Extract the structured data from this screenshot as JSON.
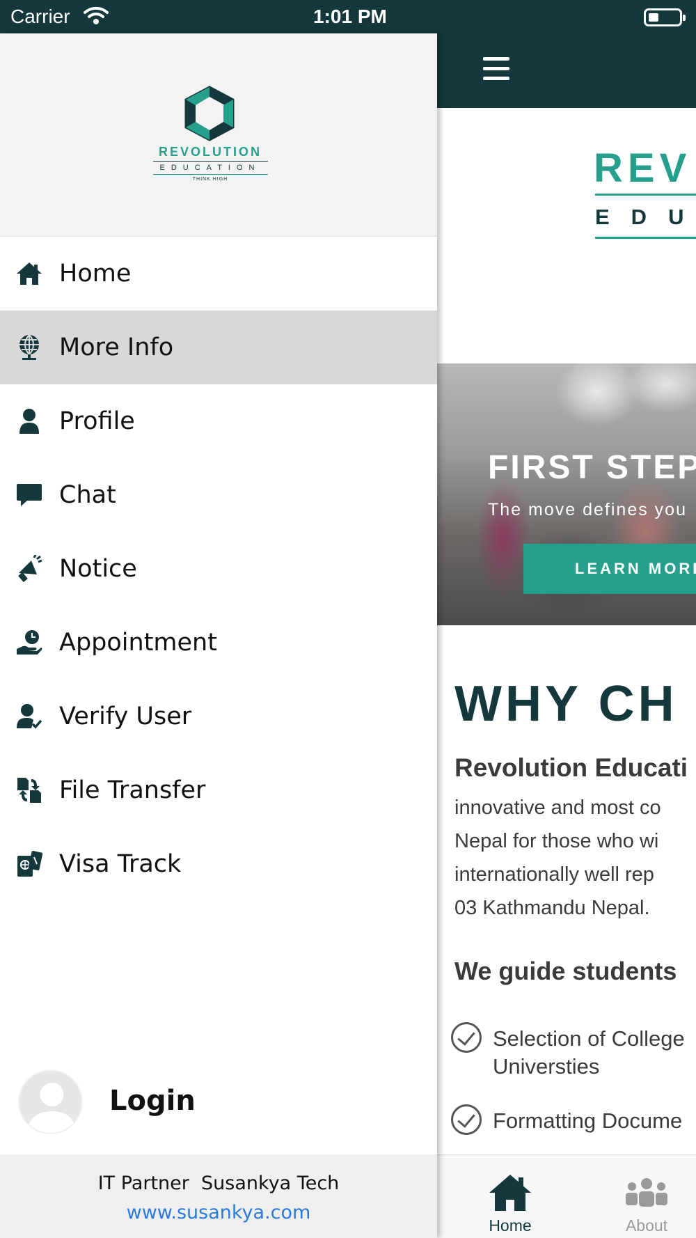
{
  "status_bar": {
    "carrier": "Carrier",
    "time": "1:01 PM"
  },
  "drawer": {
    "logo": {
      "word": "REVOLUTION",
      "sub": "EDUCATION",
      "tagline": "THINK HIGH"
    },
    "menu": [
      {
        "label": "Home",
        "icon": "home-icon"
      },
      {
        "label": "More Info",
        "icon": "globe-icon",
        "active": true
      },
      {
        "label": "Profile",
        "icon": "user-icon"
      },
      {
        "label": "Chat",
        "icon": "chat-icon"
      },
      {
        "label": "Notice",
        "icon": "megaphone-icon"
      },
      {
        "label": "Appointment",
        "icon": "hand-clock-icon"
      },
      {
        "label": "Verify User",
        "icon": "user-check-icon"
      },
      {
        "label": "File Transfer",
        "icon": "file-transfer-icon"
      },
      {
        "label": "Visa Track",
        "icon": "passport-icon"
      }
    ],
    "login_label": "Login",
    "footer": {
      "partner": "IT Partner  Susankya Tech",
      "link": "www.susankya.com"
    }
  },
  "main": {
    "logo": {
      "word": "REV",
      "sub": "EDU"
    },
    "hero": {
      "title": "FIRST STEP",
      "subtitle": "The move defines you",
      "button": "LEARN MORE"
    },
    "why_title": "WHY CH",
    "intro_heading": "Revolution Educati",
    "intro_lines": [
      "innovative and most co",
      "Nepal for those who wi",
      "internationally well rep",
      "03 Kathmandu Nepal."
    ],
    "guide_heading": "We guide students",
    "guide_items": [
      {
        "line1": "Selection of College",
        "line2": "Universties"
      },
      {
        "line1": "Formatting Docume"
      }
    ],
    "tabs": [
      {
        "label": "Home",
        "icon": "home-icon",
        "color": "#15383c"
      },
      {
        "label": "About",
        "icon": "group-icon",
        "color": "#9a9a9a"
      }
    ]
  },
  "colors": {
    "primary_dark": "#15383c",
    "accent": "#26a08c",
    "link": "#2a7ad9",
    "active_row": "#d8d8d8"
  }
}
